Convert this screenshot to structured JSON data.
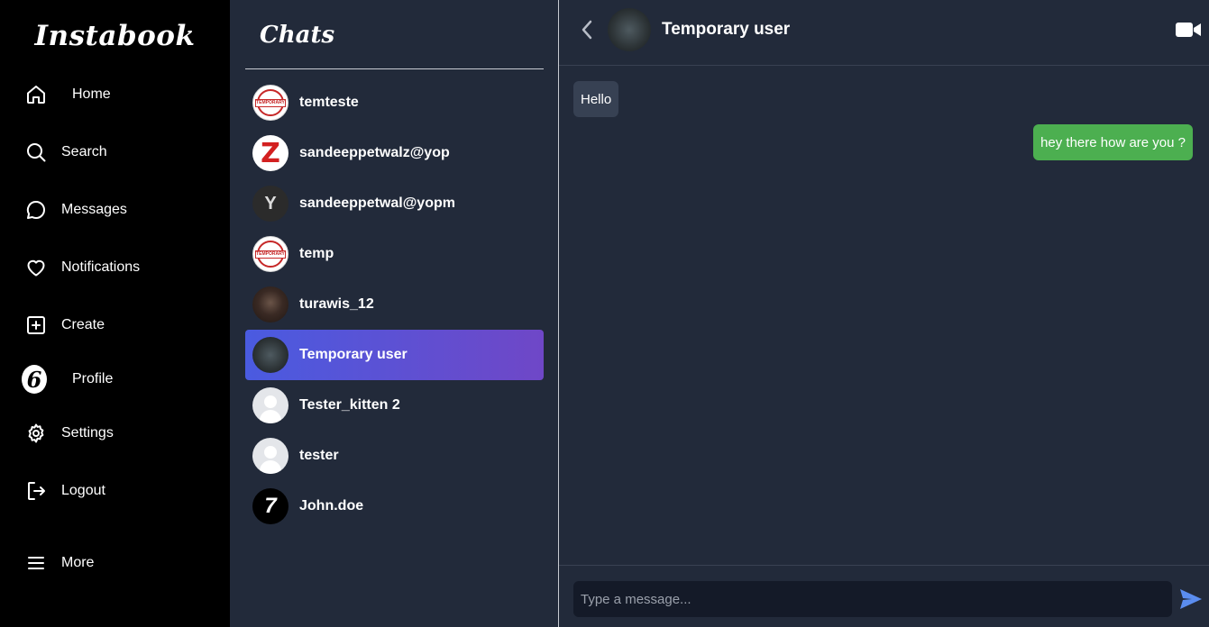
{
  "app": {
    "brand": "Instabook"
  },
  "nav": {
    "items": [
      {
        "label": "Home",
        "icon": "home-icon"
      },
      {
        "label": "Search",
        "icon": "search-icon"
      },
      {
        "label": "Messages",
        "icon": "message-icon"
      },
      {
        "label": "Notifications",
        "icon": "heart-icon"
      },
      {
        "label": "Create",
        "icon": "plus-square-icon"
      },
      {
        "label": "Profile",
        "icon": "profile-avatar"
      },
      {
        "label": "Settings",
        "icon": "gear-icon"
      },
      {
        "label": "Logout",
        "icon": "logout-icon"
      },
      {
        "label": "More",
        "icon": "hamburger-icon"
      }
    ]
  },
  "chats": {
    "title": "Chats",
    "list": [
      {
        "name": "temteste",
        "avatar": "temporary-stamp"
      },
      {
        "name": "sandeeppetwalz@yop",
        "avatar": "z-logo"
      },
      {
        "name": "sandeeppetwal@yopm",
        "avatar": "y-logo"
      },
      {
        "name": "temp",
        "avatar": "temporary-stamp"
      },
      {
        "name": "turawis_12",
        "avatar": "photo"
      },
      {
        "name": "Temporary user",
        "avatar": "photo",
        "active": true
      },
      {
        "name": "Tester_kitten 2",
        "avatar": "default-user"
      },
      {
        "name": "tester",
        "avatar": "default-user"
      },
      {
        "name": "John.doe",
        "avatar": "seven-logo"
      }
    ],
    "stamp_text": "TEMPORARY"
  },
  "conversation": {
    "contact_name": "Temporary user",
    "messages": [
      {
        "direction": "incoming",
        "text": "Hello"
      },
      {
        "direction": "outgoing",
        "text": "hey there how are you ?"
      }
    ],
    "input_placeholder": "Type a message...",
    "input_value": ""
  },
  "colors": {
    "nav_bg": "#000000",
    "panel_bg": "#222a3a",
    "active_gradient_start": "#4a5be0",
    "active_gradient_end": "#6f47c7",
    "incoming_bubble": "#374153",
    "outgoing_bubble": "#4caf50",
    "send_icon": "#5b8def"
  }
}
